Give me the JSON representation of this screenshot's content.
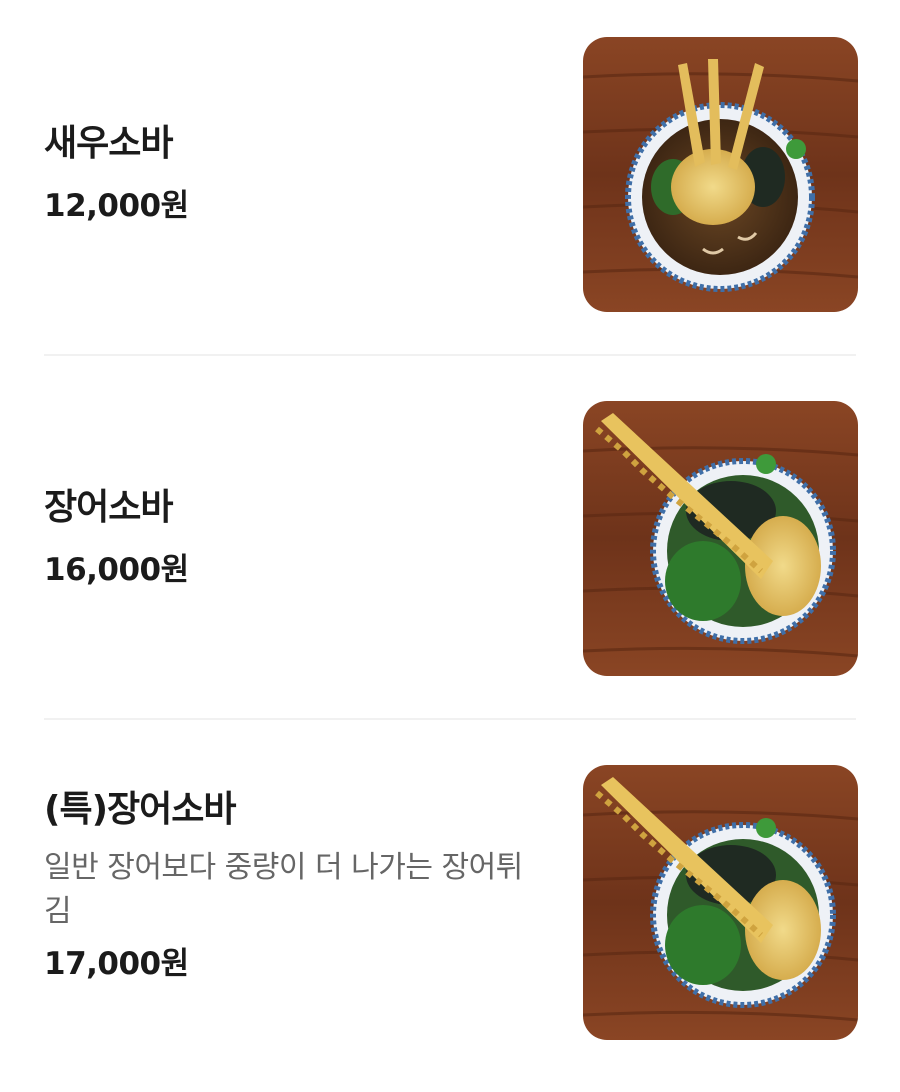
{
  "menu": {
    "items": [
      {
        "name": "새우소바",
        "description": "",
        "price": "12,000원",
        "image": "shrimp-tempura-soba-photo"
      },
      {
        "name": "장어소바",
        "description": "",
        "price": "16,000원",
        "image": "eel-tempura-soba-photo"
      },
      {
        "name": "(특)장어소바",
        "description": "일반 장어보다 중량이 더 나가는 장어튀김",
        "price": "17,000원",
        "image": "special-eel-tempura-soba-photo"
      }
    ]
  },
  "colors": {
    "wood": "#7a3b1f",
    "bowl_rim": "#3f6fa8",
    "broth": "#5a3a1e",
    "tempura": "#e7c66a"
  }
}
